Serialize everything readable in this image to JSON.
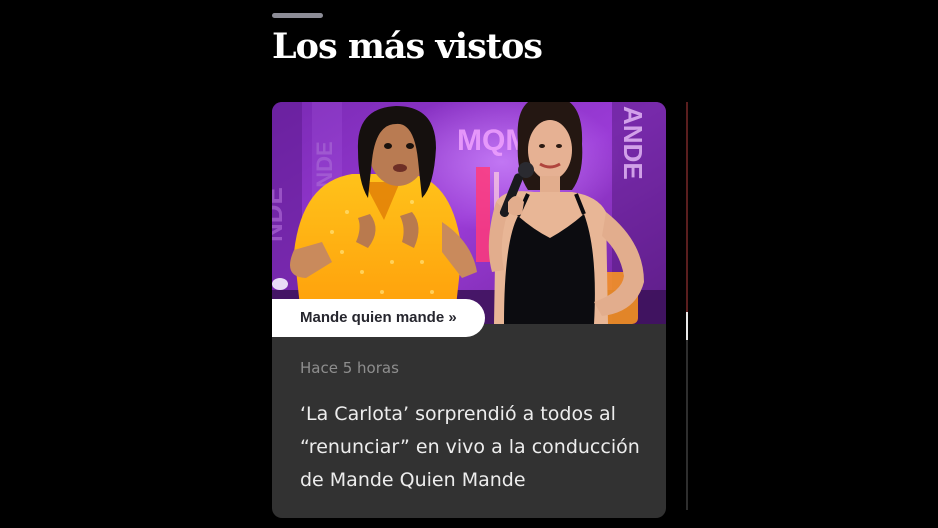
{
  "section": {
    "title": "Los más vistos"
  },
  "card": {
    "category": "Mande quien mande »",
    "time_ago": "Hace 5 horas",
    "headline": "‘La Carlota’ sorprendió a todos al “renunciar” en vivo a la conducción de Mande Quien Mande",
    "image": {
      "backdrop_text": "MQM",
      "backdrop_color": "#8e2fc4"
    }
  },
  "colors": {
    "background": "#000000",
    "card_background": "#323232",
    "pill_background": "#ffffff",
    "headline_text": "#ededed",
    "meta_text": "#8e8e8e"
  }
}
